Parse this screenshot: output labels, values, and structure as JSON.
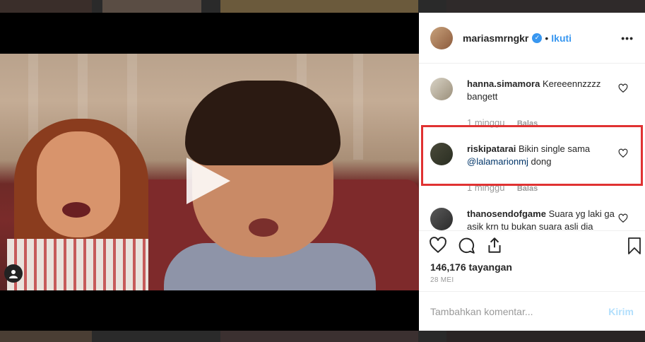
{
  "header": {
    "username": "mariasmrngkr",
    "separator": "•",
    "follow_label": "Ikuti",
    "more_label": "•••"
  },
  "comments": [
    {
      "username": "hanna.simamora",
      "text": "Kereeennzzzz bangett",
      "time": "1 minggu",
      "reply_label": "Balas"
    },
    {
      "username": "riskipatarai",
      "text_before": "Bikin single sama",
      "mention": "@lalamarionmj",
      "text_after": "dong",
      "time": "1 minggu",
      "reply_label": "Balas",
      "highlighted": true
    },
    {
      "username": "thanosendofgame",
      "text": "Suara yg laki ga asik krn tu bukan suara asli dia"
    }
  ],
  "stats": {
    "views": "146,176 tayangan",
    "date": "28 MEI"
  },
  "composer": {
    "placeholder": "Tambahkan komentar...",
    "post_label": "Kirim"
  },
  "icons": {
    "verified": "verified-badge-icon",
    "like": "heart-icon",
    "comment": "comment-bubble-icon",
    "share": "share-icon",
    "save": "bookmark-icon",
    "play": "play-icon",
    "tagged_user": "user-tag-icon"
  },
  "colors": {
    "accent": "#3897f0",
    "highlight": "#e03232",
    "post_disabled": "#b2dffc"
  }
}
